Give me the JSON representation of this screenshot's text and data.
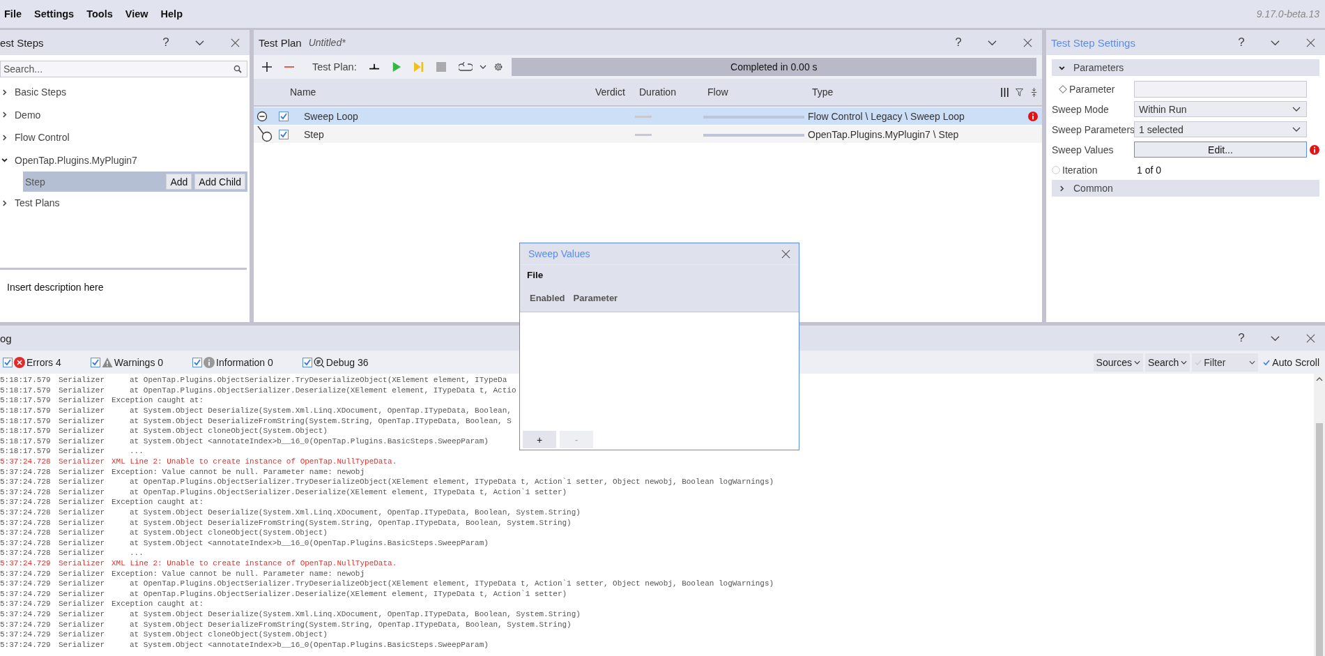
{
  "menu": [
    "File",
    "Settings",
    "Tools",
    "View",
    "Help"
  ],
  "version": "9.17.0-beta.13",
  "test_steps_panel": {
    "title": "est Steps",
    "help": "?",
    "search": {
      "placeholder": "Search..."
    },
    "tree": [
      {
        "label": "Basic Steps",
        "expanded": false
      },
      {
        "label": "Demo",
        "expanded": false
      },
      {
        "label": "Flow Control",
        "expanded": false
      },
      {
        "label": "OpenTap.Plugins.MyPlugin7",
        "expanded": true,
        "children": [
          {
            "label": "Step",
            "selected": true,
            "buttons": [
              "Add",
              "Add Child"
            ]
          }
        ]
      },
      {
        "label": "Test Plans",
        "expanded": false
      }
    ],
    "description": "Insert description here"
  },
  "test_plan_panel": {
    "title": "Test Plan",
    "file": "Untitled*",
    "help": "?",
    "toolbar_label": "Test Plan:",
    "status": "Completed in 0.00 s",
    "columns": [
      "Name",
      "Verdict",
      "Duration",
      "Flow",
      "Type"
    ],
    "rows": [
      {
        "name": "Sweep Loop",
        "checked": true,
        "selected": true,
        "expanded": true,
        "type": "Flow Control \\ Legacy \\ Sweep Loop",
        "error": true,
        "children": [
          {
            "name": "Step",
            "checked": true,
            "selected": false,
            "type": "OpenTap.Plugins.MyPlugin7 \\ Step",
            "error": false
          }
        ]
      }
    ]
  },
  "settings_panel": {
    "title": "Test Step Settings",
    "help": "?",
    "groups": [
      {
        "label": "Parameters",
        "expanded": true,
        "rows": [
          {
            "kind": "input",
            "marker": {
              "kind": "diamond"
            },
            "label": "Parameter",
            "error": false
          },
          {
            "kind": "dropdown",
            "label": "Sweep Mode",
            "value": "Within Run",
            "error": false
          },
          {
            "kind": "dropdown",
            "label": "Sweep Parameters",
            "value": "1 selected",
            "error": false
          },
          {
            "kind": "button",
            "label": "Sweep Values",
            "value": "Edit...",
            "error": true
          },
          {
            "kind": "readonly",
            "marker": {
              "kind": "circle"
            },
            "label": "Iteration",
            "value": "1 of 0",
            "error": false
          }
        ]
      },
      {
        "label": "Common",
        "expanded": false
      }
    ]
  },
  "log_panel": {
    "title": "og",
    "help": "?",
    "filters": [
      {
        "kind": "error",
        "label": "Errors 4",
        "checked": true
      },
      {
        "kind": "warning",
        "label": "Warnings 0",
        "checked": true
      },
      {
        "kind": "information",
        "label": "Information 0",
        "checked": true
      },
      {
        "kind": "debug",
        "label": "Debug 36",
        "checked": true
      }
    ],
    "tools": [
      {
        "kind": "dropdown",
        "label": "Sources"
      },
      {
        "kind": "dropdown",
        "label": "Search"
      },
      {
        "kind": "check-dropdown",
        "label": "Filter",
        "checked": false
      },
      {
        "kind": "check",
        "label": "Auto Scroll",
        "checked": true
      }
    ],
    "entries": [
      {
        "time": "5:18:17.579",
        "source": "Serializer",
        "kind": "debug",
        "indented": true,
        "message": "at OpenTap.Plugins.ObjectSerializer.TryDeserializeObject(XElement element, ITypeDa"
      },
      {
        "time": "5:18:17.579",
        "source": "Serializer",
        "kind": "debug",
        "indented": true,
        "message": "at OpenTap.Plugins.ObjectSerializer.Deserialize(XElement element, ITypeData t, Actio"
      },
      {
        "time": "5:18:17.579",
        "source": "Serializer",
        "kind": "debug",
        "indented": false,
        "message": "Exception caught at:"
      },
      {
        "time": "5:18:17.579",
        "source": "Serializer",
        "kind": "debug",
        "indented": true,
        "message": "at System.Object Deserialize(System.Xml.Linq.XDocument, OpenTap.ITypeData, Boolean,"
      },
      {
        "time": "5:18:17.579",
        "source": "Serializer",
        "kind": "debug",
        "indented": true,
        "message": "at System.Object DeserializeFromString(System.String, OpenTap.ITypeData, Boolean, S"
      },
      {
        "time": "5:18:17.579",
        "source": "Serializer",
        "kind": "debug",
        "indented": true,
        "message": "at System.Object cloneObject(System.Object)"
      },
      {
        "time": "5:18:17.579",
        "source": "Serializer",
        "kind": "debug",
        "indented": true,
        "message": "at System.Object <annotateIndex>b__16_0(OpenTap.Plugins.BasicSteps.SweepParam)"
      },
      {
        "time": "5:18:17.579",
        "source": "Serializer",
        "kind": "debug",
        "indented": true,
        "message": "..."
      },
      {
        "time": "5:37:24.728",
        "source": "Serializer",
        "kind": "error",
        "indented": false,
        "message": "XML Line 2: Unable to create instance of OpenTap.NullTypeData."
      },
      {
        "time": "5:37:24.728",
        "source": "Serializer",
        "kind": "debug",
        "indented": false,
        "message": "Exception: Value cannot be null. Parameter name: newobj"
      },
      {
        "time": "5:37:24.728",
        "source": "Serializer",
        "kind": "debug",
        "indented": true,
        "message": "at OpenTap.Plugins.ObjectSerializer.TryDeserializeObject(XElement element, ITypeData t, Action`1 setter, Object newobj, Boolean logWarnings)"
      },
      {
        "time": "5:37:24.728",
        "source": "Serializer",
        "kind": "debug",
        "indented": true,
        "message": "at OpenTap.Plugins.ObjectSerializer.Deserialize(XElement element, ITypeData t, Action`1 setter)"
      },
      {
        "time": "5:37:24.728",
        "source": "Serializer",
        "kind": "debug",
        "indented": false,
        "message": "Exception caught at:"
      },
      {
        "time": "5:37:24.728",
        "source": "Serializer",
        "kind": "debug",
        "indented": true,
        "message": "at System.Object Deserialize(System.Xml.Linq.XDocument, OpenTap.ITypeData, Boolean, System.String)"
      },
      {
        "time": "5:37:24.728",
        "source": "Serializer",
        "kind": "debug",
        "indented": true,
        "message": "at System.Object DeserializeFromString(System.String, OpenTap.ITypeData, Boolean, System.String)"
      },
      {
        "time": "5:37:24.728",
        "source": "Serializer",
        "kind": "debug",
        "indented": true,
        "message": "at System.Object cloneObject(System.Object)"
      },
      {
        "time": "5:37:24.728",
        "source": "Serializer",
        "kind": "debug",
        "indented": true,
        "message": "at System.Object <annotateIndex>b__16_0(OpenTap.Plugins.BasicSteps.SweepParam)"
      },
      {
        "time": "5:37:24.728",
        "source": "Serializer",
        "kind": "debug",
        "indented": true,
        "message": "..."
      },
      {
        "time": "5:37:24.729",
        "source": "Serializer",
        "kind": "error",
        "indented": false,
        "message": "XML Line 2: Unable to create instance of OpenTap.NullTypeData."
      },
      {
        "time": "5:37:24.729",
        "source": "Serializer",
        "kind": "debug",
        "indented": false,
        "message": "Exception: Value cannot be null. Parameter name: newobj"
      },
      {
        "time": "5:37:24.729",
        "source": "Serializer",
        "kind": "debug",
        "indented": true,
        "message": "at OpenTap.Plugins.ObjectSerializer.TryDeserializeObject(XElement element, ITypeData t, Action`1 setter, Object newobj, Boolean logWarnings)"
      },
      {
        "time": "5:37:24.729",
        "source": "Serializer",
        "kind": "debug",
        "indented": true,
        "message": "at OpenTap.Plugins.ObjectSerializer.Deserialize(XElement element, ITypeData t, Action`1 setter)"
      },
      {
        "time": "5:37:24.729",
        "source": "Serializer",
        "kind": "debug",
        "indented": false,
        "message": "Exception caught at:"
      },
      {
        "time": "5:37:24.729",
        "source": "Serializer",
        "kind": "debug",
        "indented": true,
        "message": "at System.Object Deserialize(System.Xml.Linq.XDocument, OpenTap.ITypeData, Boolean, System.String)"
      },
      {
        "time": "5:37:24.729",
        "source": "Serializer",
        "kind": "debug",
        "indented": true,
        "message": "at System.Object DeserializeFromString(System.String, OpenTap.ITypeData, Boolean, System.String)"
      },
      {
        "time": "5:37:24.729",
        "source": "Serializer",
        "kind": "debug",
        "indented": true,
        "message": "at System.Object cloneObject(System.Object)"
      },
      {
        "time": "5:37:24.729",
        "source": "Serializer",
        "kind": "debug",
        "indented": true,
        "message": "at System.Object <annotateIndex>b__16_0(OpenTap.Plugins.BasicSteps.SweepParam)"
      }
    ]
  },
  "dialog": {
    "title": "Sweep Values",
    "menu": [
      "File"
    ],
    "columns": [
      "Enabled",
      "Parameter"
    ],
    "buttons": [
      {
        "label": "+",
        "disabled": false
      },
      {
        "label": "-",
        "disabled": true
      }
    ]
  }
}
